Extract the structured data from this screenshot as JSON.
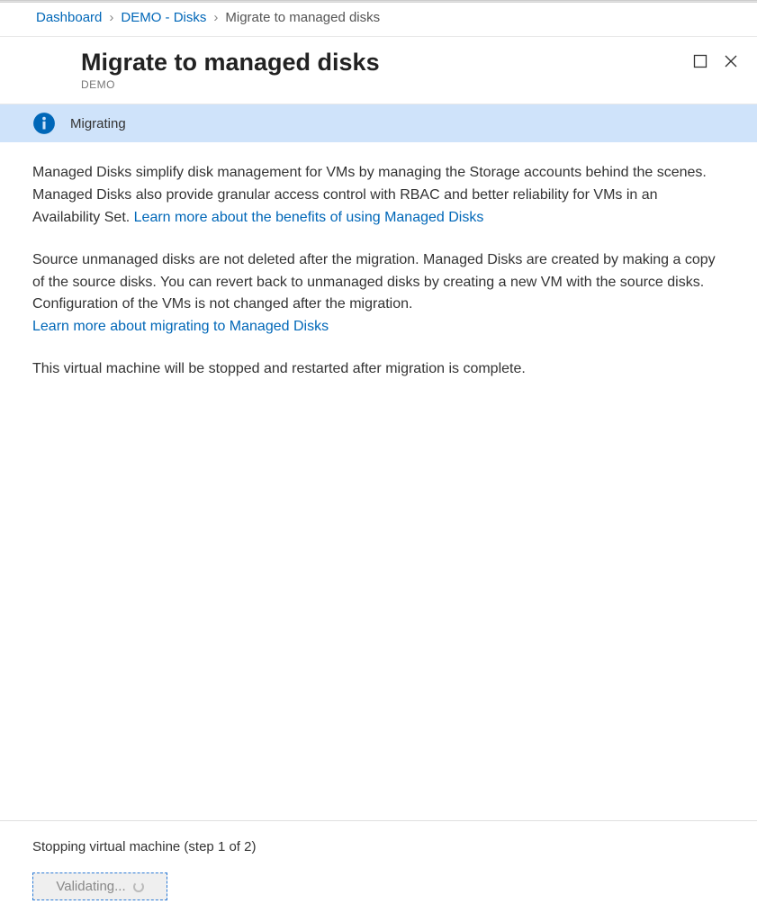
{
  "breadcrumb": {
    "item1": "Dashboard",
    "item2": "DEMO - Disks",
    "item3": "Migrate to managed disks"
  },
  "header": {
    "title": "Migrate to managed disks",
    "subtitle": "DEMO"
  },
  "banner": {
    "status": "Migrating"
  },
  "content": {
    "p1_text": "Managed Disks simplify disk management for VMs by managing the Storage accounts behind the scenes. Managed Disks also provide granular access control with RBAC and better reliability for VMs in an Availability Set. ",
    "p1_link": "Learn more about the benefits of using Managed Disks",
    "p2_text": "Source unmanaged disks are not deleted after the migration. Managed Disks are created by making a copy of the source disks. You can revert back to unmanaged disks by creating a new VM with the source disks. Configuration of the VMs is not changed after the migration. ",
    "p2_link": "Learn more about migrating to Managed Disks",
    "p3_text": "This virtual machine will be stopped and restarted after migration is complete."
  },
  "footer": {
    "status": "Stopping virtual machine (step 1 of 2)",
    "button_label": "Validating..."
  }
}
